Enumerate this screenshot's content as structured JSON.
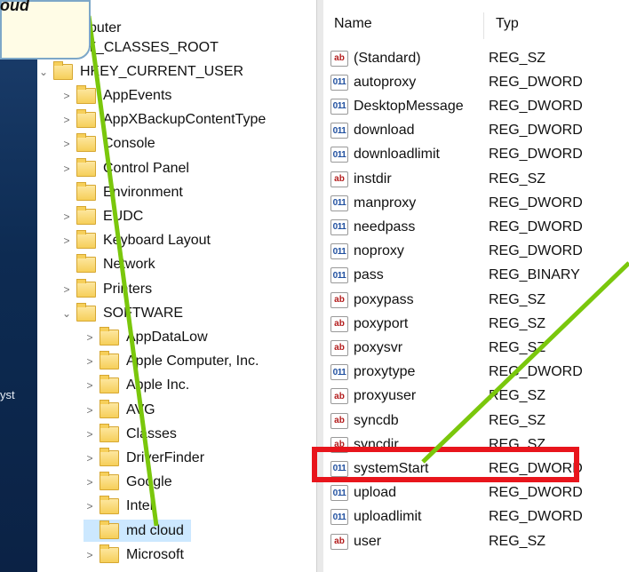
{
  "desktop_text": "yst",
  "callout_text": "oud",
  "tree": {
    "root_label": "puter",
    "items": [
      {
        "label": "KEY_CLASSES_ROOT",
        "expander": ""
      },
      {
        "label": "HKEY_CURRENT_USER",
        "expander": "⌄"
      },
      {
        "label": "AppEvents",
        "expander": ">"
      },
      {
        "label": "AppXBackupContentType",
        "expander": ">"
      },
      {
        "label": "Console",
        "expander": ">"
      },
      {
        "label": "Control Panel",
        "expander": ">"
      },
      {
        "label": "Environment",
        "expander": ""
      },
      {
        "label": "EUDC",
        "expander": ">"
      },
      {
        "label": "Keyboard Layout",
        "expander": ">"
      },
      {
        "label": "Network",
        "expander": ""
      },
      {
        "label": "Printers",
        "expander": ">"
      },
      {
        "label": "SOFTWARE",
        "expander": "⌄"
      },
      {
        "label": "AppDataLow",
        "expander": ">"
      },
      {
        "label": "Apple Computer, Inc.",
        "expander": ">"
      },
      {
        "label": "Apple Inc.",
        "expander": ">"
      },
      {
        "label": "AVG",
        "expander": ">"
      },
      {
        "label": "Classes",
        "expander": ">"
      },
      {
        "label": "DriverFinder",
        "expander": ">"
      },
      {
        "label": "Google",
        "expander": ">"
      },
      {
        "label": "Intel",
        "expander": ">"
      },
      {
        "label": "md cloud",
        "expander": ""
      },
      {
        "label": "Microsoft",
        "expander": ">"
      }
    ]
  },
  "values": {
    "col_name": "Name",
    "col_type": "Typ",
    "rows": [
      {
        "name": "(Standard)",
        "type": "REG_SZ",
        "icon": "ab"
      },
      {
        "name": "autoproxy",
        "type": "REG_DWORD",
        "icon": "011"
      },
      {
        "name": "DesktopMessage",
        "type": "REG_DWORD",
        "icon": "011"
      },
      {
        "name": "download",
        "type": "REG_DWORD",
        "icon": "011"
      },
      {
        "name": "downloadlimit",
        "type": "REG_DWORD",
        "icon": "011"
      },
      {
        "name": "instdir",
        "type": "REG_SZ",
        "icon": "ab"
      },
      {
        "name": "manproxy",
        "type": "REG_DWORD",
        "icon": "011"
      },
      {
        "name": "needpass",
        "type": "REG_DWORD",
        "icon": "011"
      },
      {
        "name": "noproxy",
        "type": "REG_DWORD",
        "icon": "011"
      },
      {
        "name": "pass",
        "type": "REG_BINARY",
        "icon": "011"
      },
      {
        "name": "poxypass",
        "type": "REG_SZ",
        "icon": "ab"
      },
      {
        "name": "poxyport",
        "type": "REG_SZ",
        "icon": "ab"
      },
      {
        "name": "poxysvr",
        "type": "REG_SZ",
        "icon": "ab"
      },
      {
        "name": "proxytype",
        "type": "REG_DWORD",
        "icon": "011"
      },
      {
        "name": "proxyuser",
        "type": "REG_SZ",
        "icon": "ab"
      },
      {
        "name": "syncdb",
        "type": "REG_SZ",
        "icon": "ab"
      },
      {
        "name": "syncdir",
        "type": "REG_SZ",
        "icon": "ab"
      },
      {
        "name": "systemStart",
        "type": "REG_DWORD",
        "icon": "011"
      },
      {
        "name": "upload",
        "type": "REG_DWORD",
        "icon": "011"
      },
      {
        "name": "uploadlimit",
        "type": "REG_DWORD",
        "icon": "011"
      },
      {
        "name": "user",
        "type": "REG_SZ",
        "icon": "ab"
      }
    ]
  },
  "colors": {
    "annotation_line": "#7ac70c",
    "highlight_box": "#e8151c",
    "selection": "#cce8ff"
  }
}
